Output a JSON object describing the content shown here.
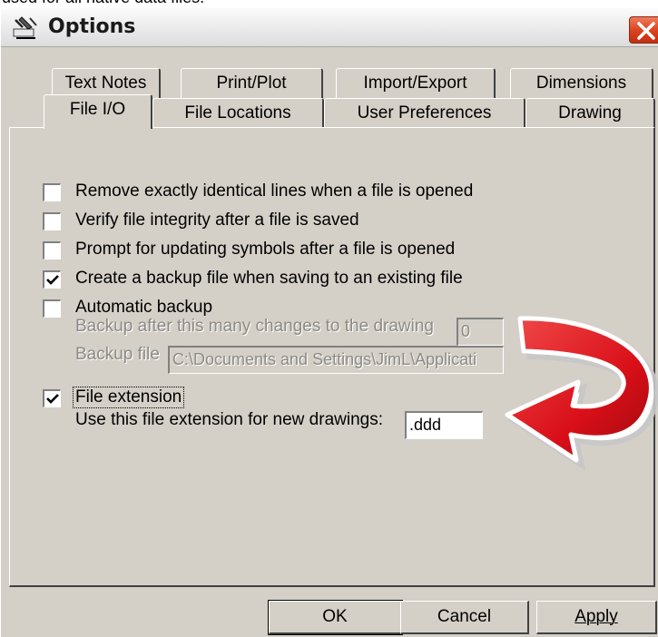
{
  "context_text": "used for all native data files.",
  "window": {
    "title": "Options"
  },
  "tabs": {
    "row1": [
      "Text Notes",
      "Print/Plot",
      "Import/Export",
      "Dimensions"
    ],
    "row2": [
      "File I/O",
      "File Locations",
      "User Preferences",
      "Drawing"
    ],
    "active": "File I/O"
  },
  "options": {
    "remove_identical": {
      "label": "Remove exactly identical lines when a file is opened",
      "checked": false
    },
    "verify_integrity": {
      "label": "Verify file integrity after a file is saved",
      "checked": false
    },
    "prompt_symbols": {
      "label": "Prompt for updating symbols after a file is opened",
      "checked": false
    },
    "create_backup": {
      "label": "Create a backup file when saving to an existing file",
      "checked": true
    },
    "automatic_backup": {
      "label": "Automatic backup",
      "checked": false,
      "changes_label": "Backup after this many changes to the drawing",
      "changes_value": "0",
      "file_label": "Backup file",
      "file_value": "C:\\Documents and Settings\\JimL\\Applicati"
    },
    "file_extension": {
      "label": "File extension",
      "checked": true,
      "use_label": "Use this file extension for new drawings:",
      "value": ".ddd"
    }
  },
  "buttons": {
    "ok": "OK",
    "cancel": "Cancel",
    "apply": "Apply"
  },
  "colors": {
    "face": "#d4d0c8",
    "arrow": "#e0101a",
    "close": "#d9411e"
  }
}
